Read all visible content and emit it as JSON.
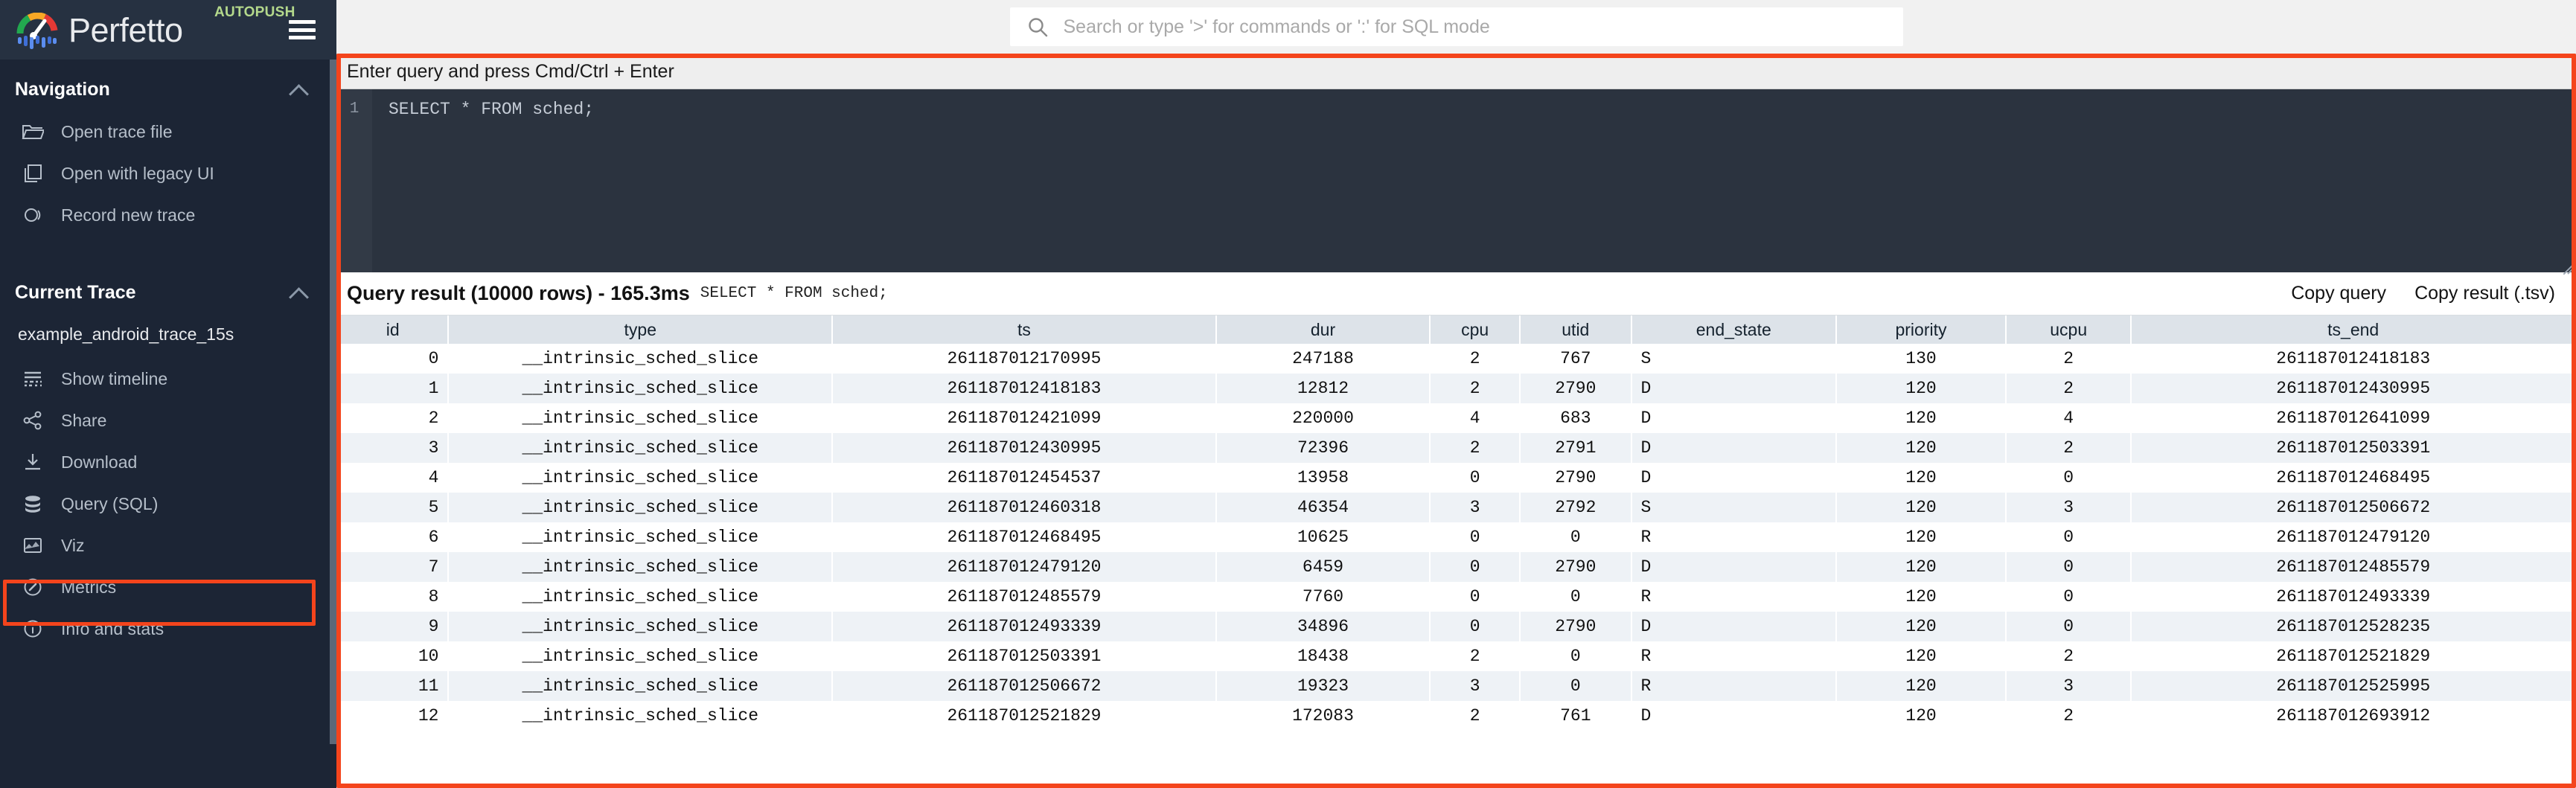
{
  "app": {
    "brand": "Perfetto",
    "badge": "AUTOPUSH",
    "menu_icon": "hamburger-icon"
  },
  "omnibox": {
    "placeholder": "Search or type '>' for commands or ':' for SQL mode",
    "value": "",
    "icon": "search-icon"
  },
  "sidebar": {
    "sections": [
      {
        "title": "Navigation",
        "collapse_icon": "chevron-up-icon",
        "items": [
          {
            "label": "Open trace file",
            "icon": "folder-open-icon",
            "active": false
          },
          {
            "label": "Open with legacy UI",
            "icon": "copy-icon",
            "active": false
          },
          {
            "label": "Record new trace",
            "icon": "record-icon",
            "active": false
          }
        ]
      },
      {
        "title": "Current Trace",
        "collapse_icon": "chevron-up-icon",
        "trace_name": "example_android_trace_15s",
        "items": [
          {
            "label": "Show timeline",
            "icon": "timeline-icon",
            "active": false
          },
          {
            "label": "Share",
            "icon": "share-icon",
            "active": false
          },
          {
            "label": "Download",
            "icon": "download-icon",
            "active": false
          },
          {
            "label": "Query (SQL)",
            "icon": "database-icon",
            "active": true
          },
          {
            "label": "Viz",
            "icon": "chart-area-icon",
            "active": false
          },
          {
            "label": "Metrics",
            "icon": "speedometer-icon",
            "active": false
          },
          {
            "label": "Info and stats",
            "icon": "info-circle-icon",
            "active": false
          }
        ]
      }
    ]
  },
  "editor": {
    "hint": "Enter query and press Cmd/Ctrl + Enter",
    "line_number": "1",
    "query": "SELECT * FROM sched;"
  },
  "result": {
    "title": "Query result (10000 rows) - 165.3ms",
    "query_echo": "SELECT * FROM sched;",
    "copy_query_label": "Copy query",
    "copy_result_label": "Copy result (.tsv)",
    "columns": [
      "id",
      "type",
      "ts",
      "dur",
      "cpu",
      "utid",
      "end_state",
      "priority",
      "ucpu",
      "ts_end"
    ],
    "rows": [
      [
        "0",
        "__intrinsic_sched_slice",
        "261187012170995",
        "247188",
        "2",
        "767",
        "S",
        "130",
        "2",
        "261187012418183"
      ],
      [
        "1",
        "__intrinsic_sched_slice",
        "261187012418183",
        "12812",
        "2",
        "2790",
        "D",
        "120",
        "2",
        "261187012430995"
      ],
      [
        "2",
        "__intrinsic_sched_slice",
        "261187012421099",
        "220000",
        "4",
        "683",
        "D",
        "120",
        "4",
        "261187012641099"
      ],
      [
        "3",
        "__intrinsic_sched_slice",
        "261187012430995",
        "72396",
        "2",
        "2791",
        "D",
        "120",
        "2",
        "261187012503391"
      ],
      [
        "4",
        "__intrinsic_sched_slice",
        "261187012454537",
        "13958",
        "0",
        "2790",
        "D",
        "120",
        "0",
        "261187012468495"
      ],
      [
        "5",
        "__intrinsic_sched_slice",
        "261187012460318",
        "46354",
        "3",
        "2792",
        "S",
        "120",
        "3",
        "261187012506672"
      ],
      [
        "6",
        "__intrinsic_sched_slice",
        "261187012468495",
        "10625",
        "0",
        "0",
        "R",
        "120",
        "0",
        "261187012479120"
      ],
      [
        "7",
        "__intrinsic_sched_slice",
        "261187012479120",
        "6459",
        "0",
        "2790",
        "D",
        "120",
        "0",
        "261187012485579"
      ],
      [
        "8",
        "__intrinsic_sched_slice",
        "261187012485579",
        "7760",
        "0",
        "0",
        "R",
        "120",
        "0",
        "261187012493339"
      ],
      [
        "9",
        "__intrinsic_sched_slice",
        "261187012493339",
        "34896",
        "0",
        "2790",
        "D",
        "120",
        "0",
        "261187012528235"
      ],
      [
        "10",
        "__intrinsic_sched_slice",
        "261187012503391",
        "18438",
        "2",
        "0",
        "R",
        "120",
        "2",
        "261187012521829"
      ],
      [
        "11",
        "__intrinsic_sched_slice",
        "261187012506672",
        "19323",
        "3",
        "0",
        "R",
        "120",
        "3",
        "261187012525995"
      ],
      [
        "12",
        "__intrinsic_sched_slice",
        "261187012521829",
        "172083",
        "2",
        "761",
        "D",
        "120",
        "2",
        "261187012693912"
      ]
    ]
  },
  "highlights": {
    "accent_color": "#f4441c",
    "targets": [
      "sidebar-item-query-sql",
      "query-page-content"
    ]
  }
}
